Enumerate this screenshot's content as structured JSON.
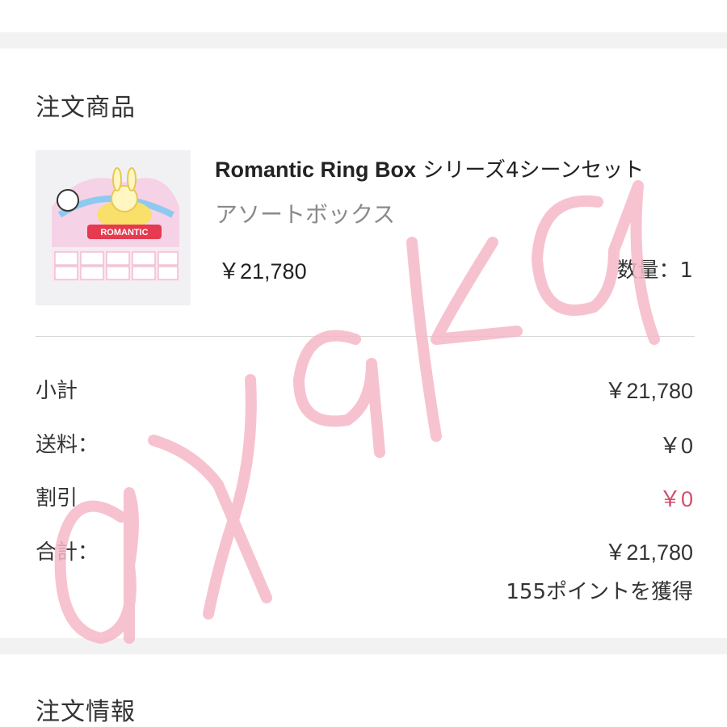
{
  "sections": {
    "order_items_title": "注文商品",
    "order_info_title": "注文情報"
  },
  "product": {
    "name_en": "Romantic Ring Box",
    "name_jp": " シリーズ4シーンセット",
    "variant": "アソートボックス",
    "price": "￥21,780",
    "quantity_label": "数量：1",
    "image_text": "ROMANTIC"
  },
  "summary": {
    "subtotal_label": "小計",
    "subtotal_value": "￥21,780",
    "shipping_label": "送料：",
    "shipping_value": "￥0",
    "discount_label": "割引",
    "discount_value": "￥0",
    "total_label": "合計：",
    "total_value": "￥21,780",
    "points_text": "155ポイントを獲得"
  },
  "watermark": {
    "text": "ayaka",
    "color": "#f6b8c8"
  },
  "colors": {
    "discount": "#d24f6e",
    "background_gap": "#f2f2f2"
  }
}
